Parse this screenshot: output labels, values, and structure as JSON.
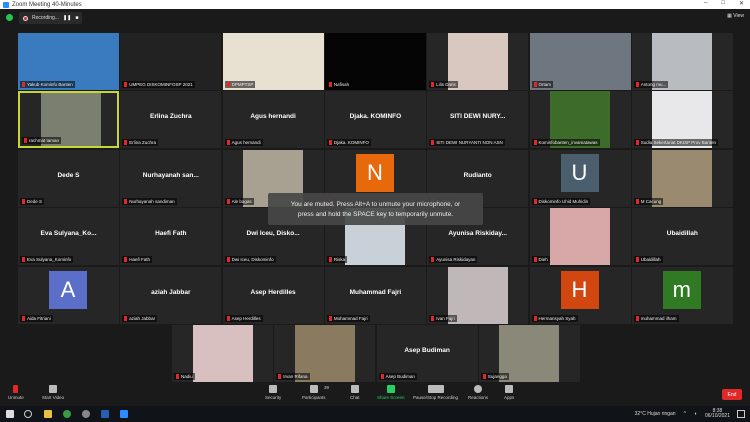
{
  "window": {
    "title": "Zoom Meeting 40-Minutes"
  },
  "topbar": {
    "recording": "Recording...",
    "view": "View"
  },
  "participants": [
    {
      "name": "Yakub Kominfo Banten",
      "kind": "video",
      "color": "#3a7bbf"
    },
    {
      "name": "UMPEG DISKOMINFOSP 2021",
      "kind": "video",
      "color": "#222"
    },
    {
      "name": "DPMPTSP",
      "kind": "video",
      "color": "#e8e0d0"
    },
    {
      "name": "Nafisah",
      "kind": "video",
      "color": "#050505"
    },
    {
      "name": "Lilis Daris",
      "kind": "video",
      "color": "#d8c8c0"
    },
    {
      "name": "Ortam",
      "kind": "video",
      "color": "#6e7680"
    },
    {
      "name": "Antong mu...",
      "kind": "video",
      "color": "#b8bcc0"
    },
    {
      "name": "rachmat taman",
      "kind": "video",
      "color": "#7a7f70",
      "active": true
    },
    {
      "name": "Erlina Zuchra",
      "kind": "name",
      "display": "Erlina Zuchra"
    },
    {
      "name": "Agus hernandi",
      "kind": "name",
      "display": "Agus hernandi"
    },
    {
      "name": "Djaka. KOMINFO",
      "kind": "name",
      "display": "Djaka. KOMINFO"
    },
    {
      "name": "SITI DEWI NURYANTI NON ASN",
      "kind": "name",
      "display": "SITI DEWI NURY..."
    },
    {
      "name": "Kominfobanten_invamatawas",
      "kind": "video",
      "color": "#3c6b2a"
    },
    {
      "name": "Sudia Sekertariat DKISP Prov Banten",
      "kind": "video",
      "color": "#e8e8ea"
    },
    {
      "name": "Dede S",
      "kind": "name",
      "display": "Dede S"
    },
    {
      "name": "Nurhayanah sandiman",
      "kind": "name",
      "display": "Nurhayanah san..."
    },
    {
      "name": "Ale bagas",
      "kind": "video",
      "color": "#a8a090"
    },
    {
      "name": "",
      "kind": "avatar",
      "letter": "N",
      "color": "#e8690c"
    },
    {
      "name": "Rudianto",
      "kind": "name",
      "display": "Rudianto"
    },
    {
      "name": "Diskominfo Uhid Muhidin",
      "kind": "avatar",
      "letter": "U",
      "color": "#4a5e6e"
    },
    {
      "name": "M Cacung",
      "kind": "video",
      "color": "#9a8a70"
    },
    {
      "name": "Eva Sulyana_Kominfo",
      "kind": "name",
      "display": "Eva Sulyana_Ko..."
    },
    {
      "name": "Haefi Fath",
      "kind": "name",
      "display": "Haefi Fath"
    },
    {
      "name": "Dwi Iceu, Diskominfo",
      "kind": "name",
      "display": "Dwi Iceu, Disko..."
    },
    {
      "name": "Riska",
      "kind": "video",
      "color": "#c8d0d8"
    },
    {
      "name": "Ayunisa Riskidayan",
      "kind": "name",
      "display": "Ayunisa Riskiday..."
    },
    {
      "name": "Dieh",
      "kind": "video",
      "color": "#d8a8a8"
    },
    {
      "name": "Ubaidillah",
      "kind": "name",
      "display": "Ubaidillah"
    },
    {
      "name": "Aida Fitriani",
      "kind": "avatar",
      "letter": "A",
      "color": "#5b6fc8"
    },
    {
      "name": "aziah Jabbar",
      "kind": "name",
      "display": "aziah Jabbar"
    },
    {
      "name": "Asep Herdilles",
      "kind": "name",
      "display": "Asep Herdilles"
    },
    {
      "name": "Muhammad Fajri",
      "kind": "name",
      "display": "Muhammad Fajri"
    },
    {
      "name": "Ivan Fajri",
      "kind": "video",
      "color": "#c0b8b8"
    },
    {
      "name": "Hermansyah Syah",
      "kind": "avatar",
      "letter": "H",
      "color": "#d2460f"
    },
    {
      "name": "muhammad ilham",
      "kind": "avatar",
      "letter": "m",
      "color": "#2f7a22"
    },
    {
      "name": "Nadiu",
      "kind": "video",
      "color": "#d8c0c0"
    },
    {
      "name": "Irvan Rifana",
      "kind": "video",
      "color": "#8a7a60"
    },
    {
      "name": "Asep Budiman",
      "kind": "name",
      "display": "Asep Budiman"
    },
    {
      "name": "Sujangga",
      "kind": "video",
      "color": "#8a8878"
    }
  ],
  "toast": {
    "line1": "You are muted. Press Alt+A to unmute your microphone, or",
    "line2": "press and hold the SPACE key to temporarily unmute."
  },
  "toolbar": {
    "unmute": "Unmute",
    "start_video": "Start Video",
    "security": "Security",
    "participants": "Participants",
    "participant_count": "39",
    "chat": "Chat",
    "share_screen": "Share Screen",
    "recording": "Pause/Stop Recording",
    "reactions": "Reactions",
    "apps": "Apps",
    "end": "End"
  },
  "taskbar": {
    "weather": "32°C  Hujan ringan",
    "time": "8:38",
    "date": "06/10/2021"
  }
}
